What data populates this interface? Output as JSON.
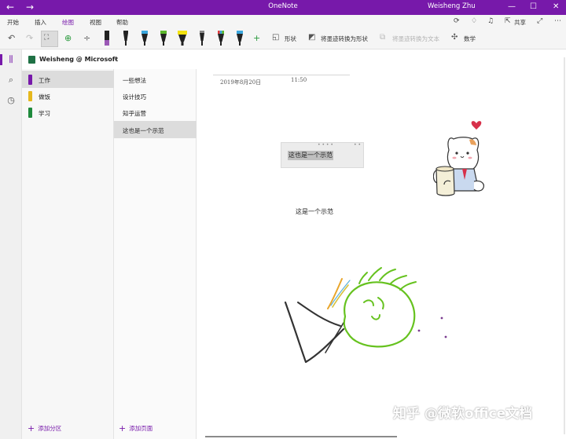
{
  "window": {
    "title": "OneNote",
    "user": "Weisheng Zhu"
  },
  "menu": {
    "tabs": [
      "开始",
      "插入",
      "绘图",
      "视图",
      "帮助"
    ],
    "active_tab": "绘图",
    "share_label": "共享"
  },
  "toolbar": {
    "shapes_label": "形状",
    "ink_to_shape_label": "将墨迹转换为形状",
    "ink_to_text_label": "将墨迹转换为文本",
    "math_label": "数学",
    "pens": [
      {
        "cap": "#9b59b6",
        "body": "#222222"
      },
      {
        "cap": "#222222",
        "body": "#222222"
      },
      {
        "cap": "#3aa6dd",
        "body": "#222222"
      },
      {
        "cap": "#5cb82c",
        "body": "#222222"
      },
      {
        "cap": "#f2e20f",
        "body": "#222222"
      },
      {
        "cap": "#888888",
        "body": "#222222"
      },
      {
        "cap": "#e03a3a",
        "body": "#222222"
      },
      {
        "cap": "#3aa6dd",
        "body": "#222222"
      }
    ]
  },
  "notebook": {
    "name": "Weisheng @ Microsoft",
    "color": "#1f7145"
  },
  "sections": [
    {
      "label": "工作",
      "color": "#7719aa",
      "selected": true
    },
    {
      "label": "做饭",
      "color": "#e6b81d",
      "selected": false
    },
    {
      "label": "学习",
      "color": "#1f8a3c",
      "selected": false
    }
  ],
  "add_section_label": "添加分区",
  "pages": [
    {
      "label": "一些想法",
      "selected": false
    },
    {
      "label": "设计技巧",
      "selected": false
    },
    {
      "label": "知乎运营",
      "selected": false
    },
    {
      "label": "这也是一个示范",
      "selected": true
    }
  ],
  "add_page_label": "添加页面",
  "note": {
    "date": "2019年8月20日",
    "time": "11:50",
    "container_text": "这也是一个示范",
    "plain_text": "这是一个示范"
  },
  "watermark": "知乎 @微软office文档",
  "colors": {
    "accent": "#7719aa",
    "ink_green": "#66c21f",
    "ink_black": "#333333"
  }
}
